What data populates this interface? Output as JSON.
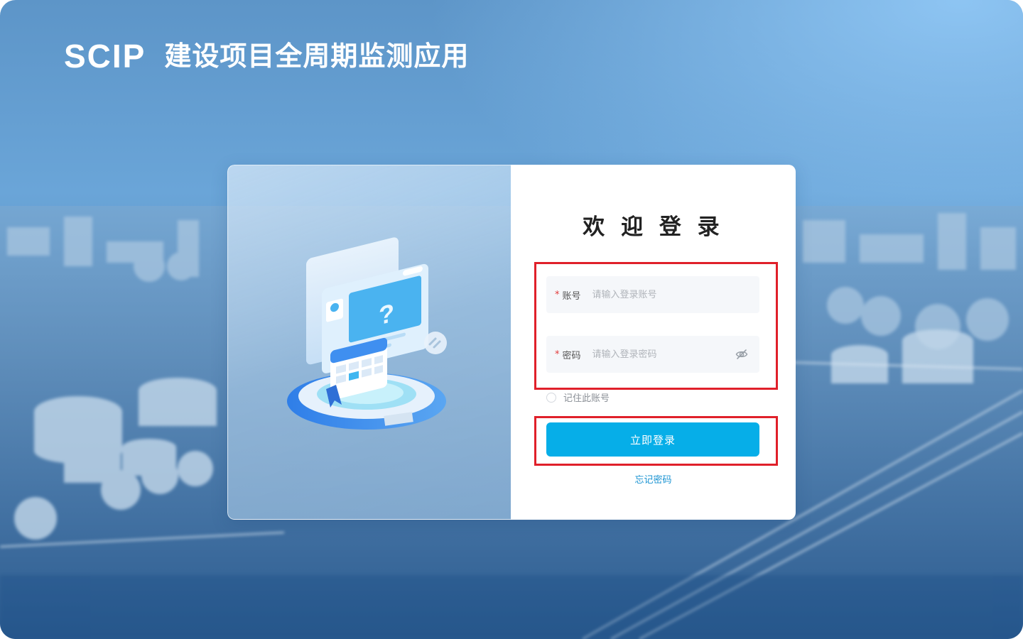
{
  "brand": {
    "logo": "SCIP",
    "title": "建设项目全周期监测应用"
  },
  "login": {
    "welcome": "欢 迎 登 录",
    "account": {
      "required_mark": "*",
      "label": "账号",
      "placeholder": "请输入登录账号",
      "value": ""
    },
    "password": {
      "required_mark": "*",
      "label": "密码",
      "placeholder": "请输入登录密码",
      "value": "",
      "toggle_icon": "eye-hidden-icon"
    },
    "remember": {
      "label": "记住此账号",
      "checked": false
    },
    "submit_label": "立即登录",
    "forgot_label": "忘记密码"
  },
  "colors": {
    "primary_button": "#06aee8",
    "link": "#1a93d2",
    "required": "#e23b3b",
    "highlight": "#e0202a"
  }
}
